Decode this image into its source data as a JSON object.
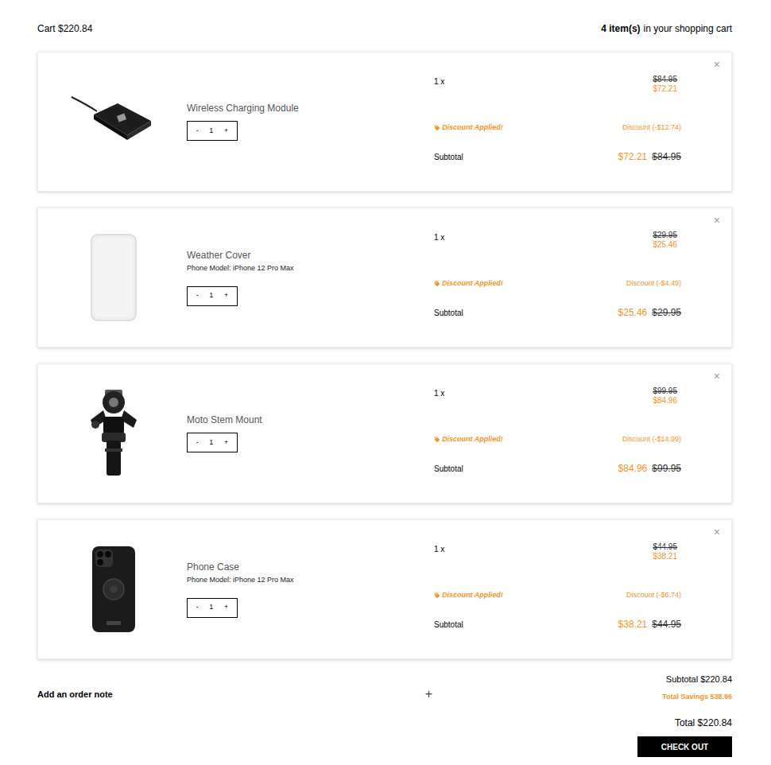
{
  "header": {
    "cart": "Cart $220.84",
    "count": "4 item(s)",
    "count_label": "in your shopping cart"
  },
  "items": [
    {
      "kind": "charger",
      "name": "Wireless Charging Module",
      "qty_minus": "-",
      "quantity": "1",
      "qty_plus": "+",
      "qty_prefix": "1 x",
      "original_price": "$84.95",
      "price": "$72.21",
      "discount_label": "Discount Applied!",
      "discount": "Discount (-$12.74)",
      "subtotal_label": "Subtotal",
      "subtotal": "$72.21",
      "subtotal_original": "$84.95",
      "remove": "×"
    },
    {
      "kind": "cover",
      "name": "Weather Cover",
      "variant": "Phone Model: iPhone 12 Pro Max",
      "qty_minus": "-",
      "quantity": "1",
      "qty_plus": "+",
      "qty_prefix": "1 x",
      "original_price": "$29.95",
      "price": "$25.46",
      "discount_label": "Discount Applied!",
      "discount": "Discount (-$4.49)",
      "subtotal_label": "Subtotal",
      "subtotal": "$25.46",
      "subtotal_original": "$29.95",
      "remove": "×"
    },
    {
      "kind": "mount",
      "name": "Moto Stem Mount",
      "qty_minus": "-",
      "quantity": "1",
      "qty_plus": "+",
      "qty_prefix": "1 x",
      "original_price": "$99.95",
      "price": "$84.96",
      "discount_label": "Discount Applied!",
      "discount": "Discount (-$14.99)",
      "subtotal_label": "Subtotal",
      "subtotal": "$84.96",
      "subtotal_original": "$99.95",
      "remove": "×"
    },
    {
      "kind": "case",
      "name": "Phone Case",
      "variant": "Phone Model: iPhone 12 Pro Max",
      "qty_minus": "-",
      "quantity": "1",
      "qty_plus": "+",
      "qty_prefix": "1 x",
      "original_price": "$44.95",
      "price": "$38.21",
      "discount_label": "Discount Applied!",
      "discount": "Discount (-$6.74)",
      "subtotal_label": "Subtotal",
      "subtotal": "$38.21",
      "subtotal_original": "$44.95",
      "remove": "×"
    }
  ],
  "order_note": {
    "label": "Add an order note",
    "toggle": "+"
  },
  "summary": {
    "subtotal": "Subtotal $220.84",
    "savings": "Total Savings $38.96",
    "total": "Total $220.84",
    "checkout": "CHECK OUT"
  }
}
